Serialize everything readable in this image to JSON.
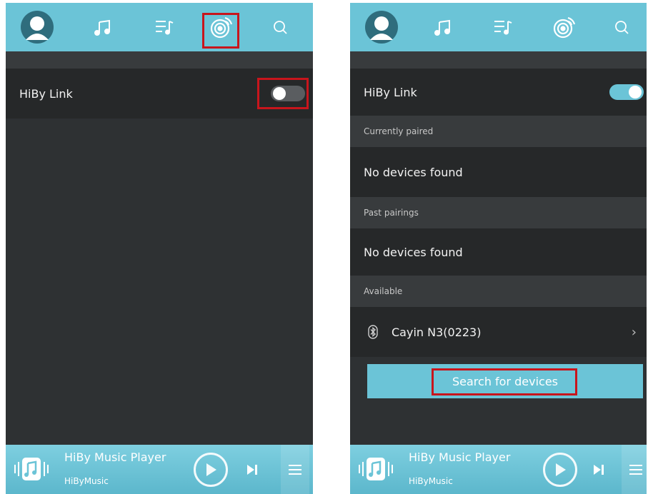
{
  "left_screen": {
    "nav": {
      "icons": [
        "avatar-icon",
        "music-note-icon",
        "playlist-icon",
        "hiby-link-icon",
        "search-icon"
      ],
      "active": "hiby-link-icon"
    },
    "hiby_link": {
      "label": "HiBy Link",
      "enabled": false
    },
    "player": {
      "title": "HiBy Music Player",
      "artist": "HiByMusic"
    }
  },
  "right_screen": {
    "nav": {
      "icons": [
        "avatar-icon",
        "music-note-icon",
        "playlist-icon",
        "hiby-link-icon",
        "search-icon"
      ]
    },
    "hiby_link": {
      "label": "HiBy Link",
      "enabled": true
    },
    "sections": {
      "currently_paired": {
        "header": "Currently paired",
        "empty_text": "No devices found"
      },
      "past_pairings": {
        "header": "Past pairings",
        "empty_text": "No devices found"
      },
      "available": {
        "header": "Available",
        "devices": [
          {
            "name": "Cayin N3(0223)",
            "icon": "bluetooth-icon"
          }
        ]
      }
    },
    "search_button": "Search for devices",
    "player": {
      "title": "HiBy Music Player",
      "artist": "HiByMusic"
    }
  },
  "colors": {
    "accent": "#6bc4d7",
    "background": "#2e3133",
    "row": "#262829",
    "section_header": "#383b3d",
    "highlight": "#c8151c"
  }
}
